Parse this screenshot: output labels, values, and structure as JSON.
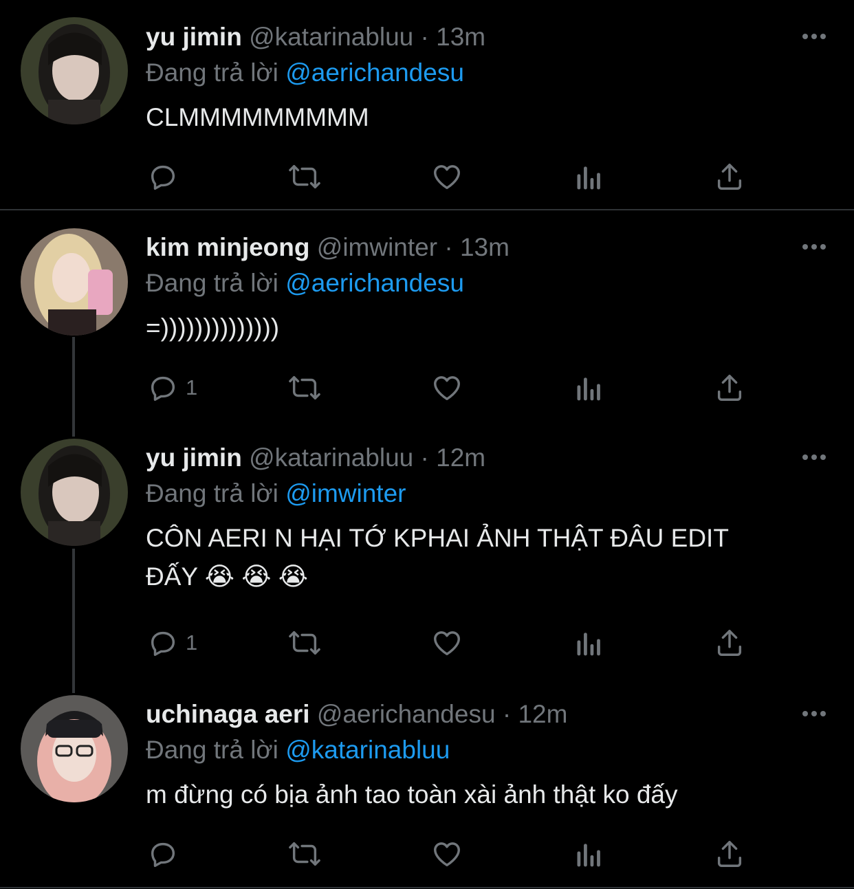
{
  "tweets": [
    {
      "name": "yu jimin",
      "handle": "@katarinabluu",
      "sep": "·",
      "time": "13m",
      "reply_prefix": "Đang trả lời",
      "reply_to": "@aerichandesu",
      "text": "CLMMMMMMMMM",
      "reply_count": "",
      "avatar_hint": "dark-hair"
    },
    {
      "name": "kim minjeong",
      "handle": "@imwinter",
      "sep": "·",
      "time": "13m",
      "reply_prefix": "Đang trả lời",
      "reply_to": "@aerichandesu",
      "text": "=))))))))))))))",
      "reply_count": "1",
      "avatar_hint": "blonde"
    },
    {
      "name": "yu jimin",
      "handle": "@katarinabluu",
      "sep": "·",
      "time": "12m",
      "reply_prefix": "Đang trả lời",
      "reply_to": "@imwinter",
      "text": "CÔN AERI N HẠI TỚ KPHAI ẢNH THẬT ĐÂU EDIT ĐẤY 😭 😭 😭",
      "reply_count": "1",
      "avatar_hint": "dark-hair"
    },
    {
      "name": "uchinaga aeri",
      "handle": "@aerichandesu",
      "sep": "·",
      "time": "12m",
      "reply_prefix": "Đang trả lời",
      "reply_to": "@katarinabluu",
      "text": "m đừng có bịa ảnh tao toàn xài ảnh thật ko đấy",
      "reply_count": "",
      "avatar_hint": "pink-hair-beanie"
    }
  ],
  "icons": [
    "reply-icon",
    "retweet-icon",
    "like-icon",
    "views-icon",
    "share-icon",
    "more-icon"
  ],
  "colors": {
    "background": "#000000",
    "text": "#e7e9ea",
    "muted": "#71767b",
    "link": "#1d9bf0",
    "line": "#333639"
  }
}
